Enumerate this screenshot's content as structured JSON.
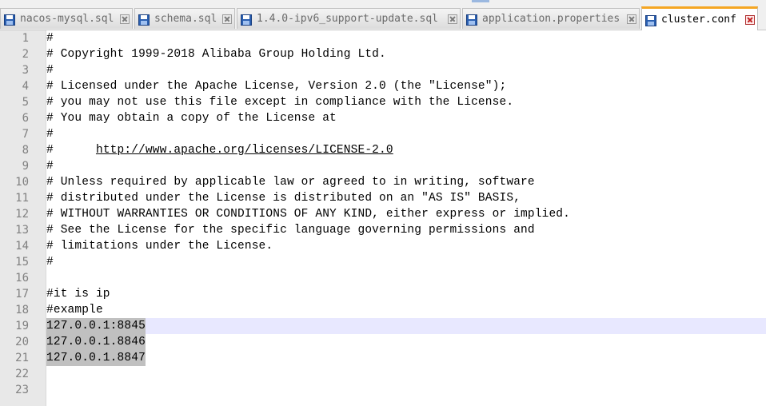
{
  "tabs": [
    {
      "label": "nacos-mysql.sql",
      "active": false,
      "icon": "save-icon"
    },
    {
      "label": "schema.sql",
      "active": false,
      "icon": "save-icon"
    },
    {
      "label": "1.4.0-ipv6_support-update.sql",
      "active": false,
      "icon": "save-icon"
    },
    {
      "label": "application.properties",
      "active": false,
      "icon": "save-icon"
    },
    {
      "label": "cluster.conf",
      "active": true,
      "icon": "save-icon"
    }
  ],
  "editor": {
    "current_line": 19,
    "selected_lines": [
      19,
      20,
      21
    ],
    "line_numbers": [
      "1",
      "2",
      "3",
      "4",
      "5",
      "6",
      "7",
      "8",
      "9",
      "10",
      "11",
      "12",
      "13",
      "14",
      "15",
      "16",
      "17",
      "18",
      "19",
      "20",
      "21",
      "22",
      "23"
    ],
    "lines": [
      "#",
      "# Copyright 1999-2018 Alibaba Group Holding Ltd.",
      "#",
      "# Licensed under the Apache License, Version 2.0 (the \"License\");",
      "# you may not use this file except in compliance with the License.",
      "# You may obtain a copy of the License at",
      "#",
      "#",
      "#",
      "# Unless required by applicable law or agreed to in writing, software",
      "# distributed under the License is distributed on an \"AS IS\" BASIS,",
      "# WITHOUT WARRANTIES OR CONDITIONS OF ANY KIND, either express or implied.",
      "# See the License for the specific language governing permissions and",
      "# limitations under the License.",
      "#",
      "",
      "#it is ip",
      "#example",
      "127.0.0.1:8845",
      "127.0.0.1.8846",
      "127.0.0.1.8847",
      "",
      ""
    ],
    "license_url": "http://www.apache.org/licenses/LICENSE-2.0"
  },
  "colors": {
    "active_tab_accent": "#f5a623",
    "current_line_highlight": "#e8e8ff",
    "selection": "#c0c0c0",
    "gutter": "#e8e8e8",
    "save_icon": "#2a5fb0"
  }
}
